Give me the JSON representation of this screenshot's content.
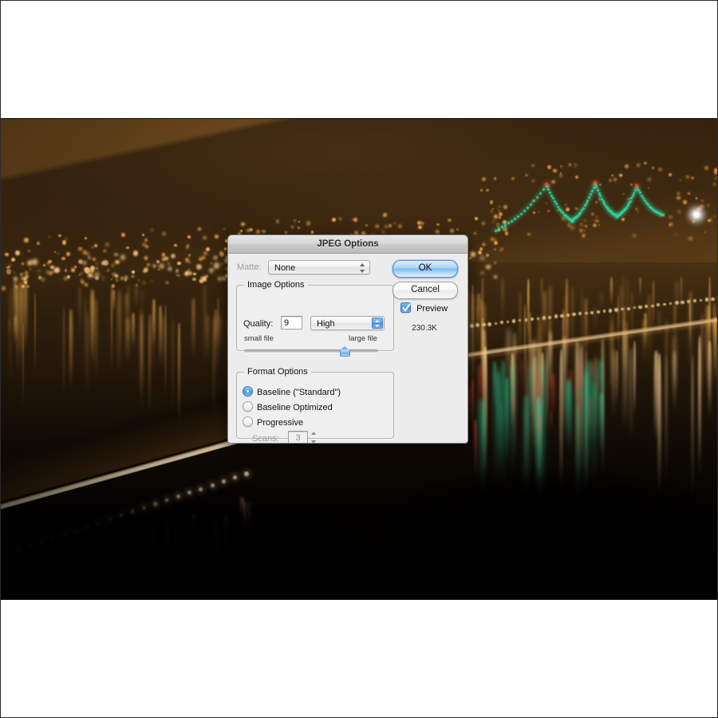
{
  "photo": {
    "description": "night-bridge-river-city-lights-photograph",
    "alt": "Night photograph of a lit suspension bridge over a river with orange city lights and reflections"
  },
  "dialog": {
    "title": "JPEG Options",
    "matte": {
      "label": "Matte:",
      "value": "None",
      "disabled": true
    },
    "image_options": {
      "group_title": "Image Options",
      "quality": {
        "label": "Quality:",
        "value": "9",
        "preset": "High"
      },
      "slider": {
        "min_label": "small file",
        "max_label": "large file",
        "value": 9,
        "min": 0,
        "max": 12,
        "percent": 75
      }
    },
    "format_options": {
      "group_title": "Format Options",
      "options": [
        {
          "label": "Baseline (\"Standard\")",
          "selected": true
        },
        {
          "label": "Baseline Optimized",
          "selected": false
        },
        {
          "label": "Progressive",
          "selected": false
        }
      ],
      "scans": {
        "label": "Scans:",
        "value": "3",
        "disabled": true
      }
    },
    "buttons": {
      "ok": "OK",
      "cancel": "Cancel"
    },
    "preview": {
      "label": "Preview",
      "checked": true
    },
    "file_size": "230.3K"
  },
  "colors": {
    "accent_blue": "#4a90da",
    "dialog_bg": "#ececec",
    "titlebar": "#d6d6d6",
    "disabled_text": "#9a9a9a",
    "photo_amber": "#ffb24d",
    "photo_green": "#2fe0a8"
  }
}
